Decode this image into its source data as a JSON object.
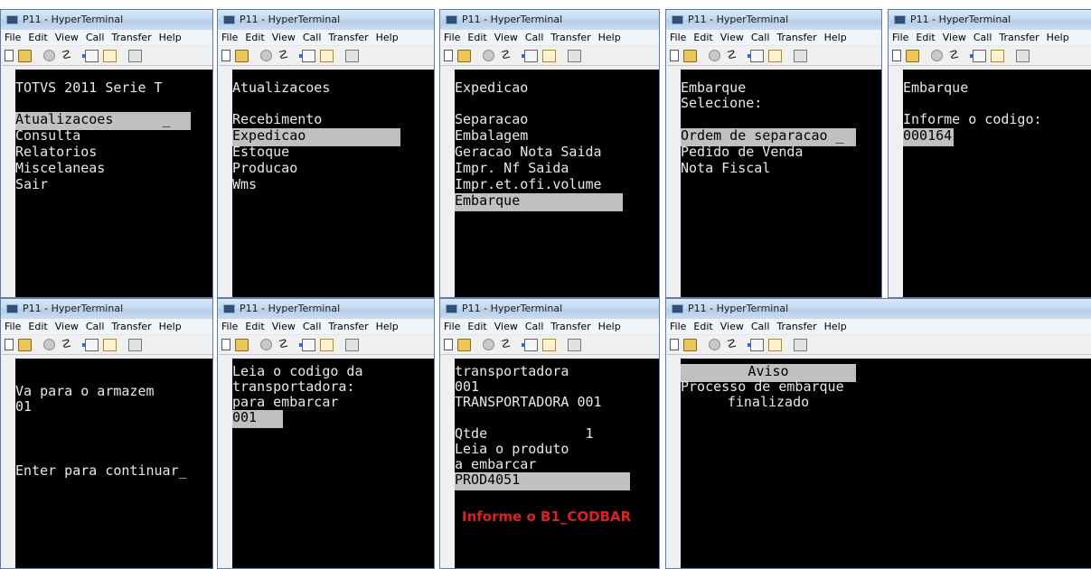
{
  "app": {
    "title": "P11 - HyperTerminal"
  },
  "menu": [
    "File",
    "Edit",
    "View",
    "Call",
    "Transfer",
    "Help"
  ],
  "toolbar_icons": [
    "new-icon",
    "open-icon",
    "call-icon",
    "hangup-icon",
    "send-icon",
    "receive-icon",
    "properties-icon"
  ],
  "colors": {
    "terminal_bg": "#000000",
    "terminal_text": "#e8e8e8",
    "highlight_bg": "#c0c0c0",
    "caption": "#e02020",
    "titlebar": "#c4d8ee"
  },
  "windows": [
    {
      "title": "P11 - HyperTerminal",
      "lines": [
        "TOTVS 2011 Serie T",
        "",
        "Atualizacoes      _",
        "Consulta",
        "Relatorios",
        "Miscelaneas",
        "Sair"
      ]
    },
    {
      "title": "P11 - HyperTerminal",
      "lines": [
        "Atualizacoes",
        "",
        "Recebimento",
        "Expedicao",
        "Estoque",
        "Producao",
        "Wms"
      ]
    },
    {
      "title": "P11 - HyperTerminal",
      "lines": [
        "Expedicao",
        "",
        "Separacao",
        "Embalagem",
        "Geracao Nota Saida",
        "Impr. Nf Saida",
        "Impr.et.ofi.volume",
        "Embarque"
      ]
    },
    {
      "title": "P11 - HyperTerminal",
      "lines": [
        "Embarque",
        "Selecione:",
        "",
        "Ordem de separacao _",
        "Pedido de Venda",
        "Nota Fiscal"
      ]
    },
    {
      "title": "P11 - HyperTerminal",
      "lines": [
        "Embarque",
        "",
        "Informe o codigo:",
        "000164"
      ]
    },
    {
      "title": "P11 - HyperTerminal",
      "lines": [
        "Va para o armazem",
        "01",
        "",
        "",
        "",
        "Enter para continuar_"
      ]
    },
    {
      "title": "P11 - HyperTerminal",
      "lines": [
        "Leia o codigo da",
        "transportadora:",
        "para embarcar",
        "001"
      ]
    },
    {
      "title": "P11 - HyperTerminal",
      "lines": [
        "transportadora",
        "001",
        "TRANSPORTADORA 001",
        "",
        "Qtde            1",
        "Leia o produto",
        "a embarcar",
        "PROD4051"
      ],
      "caption": "Informe o B1_CODBAR"
    },
    {
      "title": "P11 - HyperTerminal",
      "lines": [
        "Aviso",
        "Processo de embarque",
        "finalizado"
      ]
    }
  ]
}
